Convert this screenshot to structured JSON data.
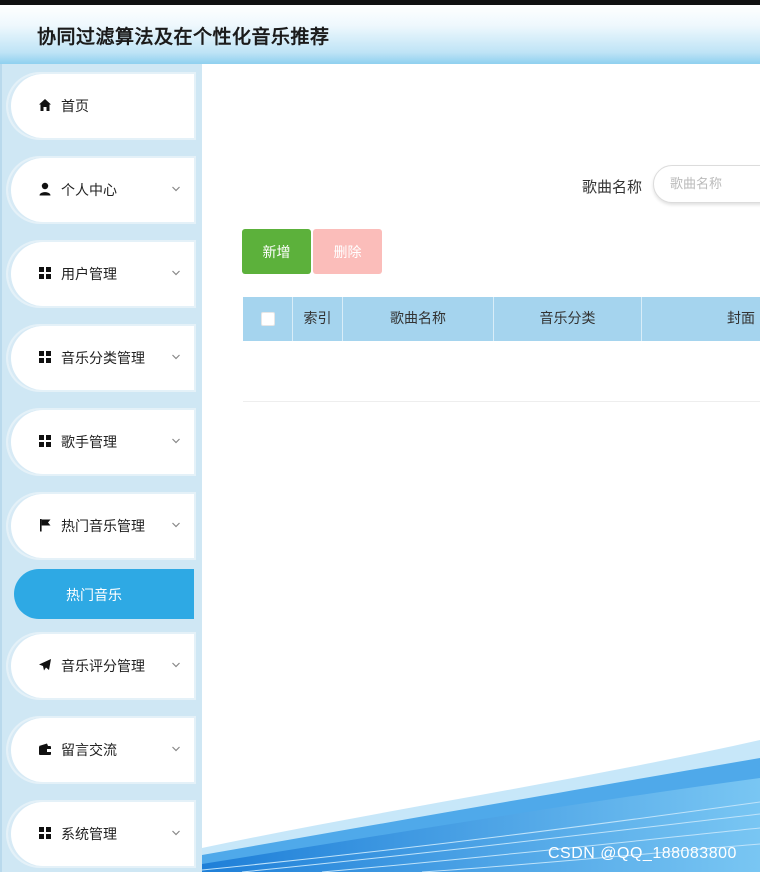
{
  "header": {
    "title": "协同过滤算法及在个性化音乐推荐"
  },
  "sidebar": {
    "items": [
      {
        "label": "首页",
        "icon": "home-icon"
      },
      {
        "label": "个人中心",
        "icon": "user-icon"
      },
      {
        "label": "用户管理",
        "icon": "grid-icon"
      },
      {
        "label": "音乐分类管理",
        "icon": "grid-icon"
      },
      {
        "label": "歌手管理",
        "icon": "grid-icon"
      },
      {
        "label": "热门音乐管理",
        "icon": "flag-icon"
      },
      {
        "label": "音乐评分管理",
        "icon": "paper-plane-icon"
      },
      {
        "label": "留言交流",
        "icon": "wallet-icon"
      },
      {
        "label": "系统管理",
        "icon": "grid-icon"
      }
    ],
    "active_subitem": {
      "label": "热门音乐"
    }
  },
  "search": {
    "label": "歌曲名称",
    "placeholder": "歌曲名称",
    "value": ""
  },
  "toolbar": {
    "add_label": "新增",
    "delete_label": "删除"
  },
  "table": {
    "columns": [
      "索引",
      "歌曲名称",
      "音乐分类",
      "封面"
    ],
    "rows": []
  },
  "watermark": "CSDN @QQ_188083800",
  "colors": {
    "accent": "#2ea9e4",
    "sidebar_bg": "#cfe7f4",
    "table_header": "#a5d4ee",
    "add_button": "#5cb13b",
    "delete_button": "#fbbdba"
  }
}
